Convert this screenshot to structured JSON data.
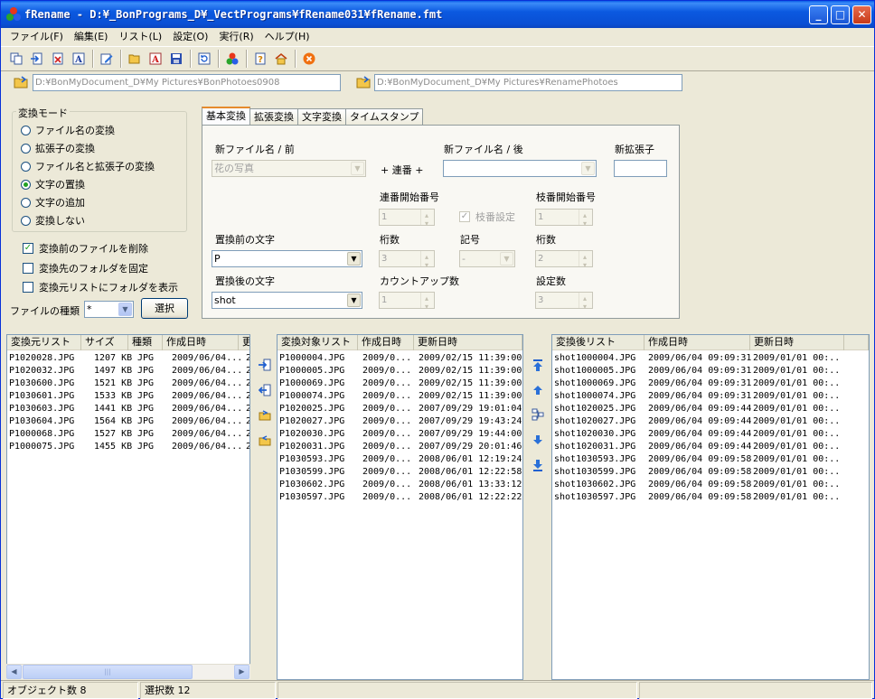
{
  "window": {
    "title": "fRename - D:¥_BonPrograms_D¥_VectPrograms¥fRename031¥fRename.fmt",
    "minimize": "_",
    "maximize": "□",
    "close": "✕"
  },
  "menu": [
    "ファイル(F)",
    "編集(E)",
    "リスト(L)",
    "設定(O)",
    "実行(R)",
    "ヘルプ(H)"
  ],
  "paths": {
    "source": "D:¥BonMyDocument_D¥My Pictures¥BonPhotoes0908",
    "target": "D:¥BonMyDocument_D¥My Pictures¥RenamePhotoes"
  },
  "mode": {
    "title": "変換モード",
    "options": [
      "ファイル名の変換",
      "拡張子の変換",
      "ファイル名と拡張子の変換",
      "文字の置換",
      "文字の追加",
      "変換しない"
    ],
    "selected_index": 3
  },
  "options": {
    "delete_source": "変換前のファイルを削除",
    "fix_target_folder": "変換先のフォルダを固定",
    "show_folders": "変換元リストにフォルダを表示"
  },
  "filetype": {
    "label": "ファイルの種類",
    "value": "*",
    "select_button": "選択"
  },
  "tabs": [
    "基本変換",
    "拡張変換",
    "文字変換",
    "タイムスタンプ"
  ],
  "basic": {
    "new_name_front_label": "新ファイル名 / 前",
    "new_name_front_value": "花の写真",
    "plus_serial": "+ 連番 +",
    "new_name_back_label": "新ファイル名 / 後",
    "new_name_back_value": "",
    "new_ext_label": "新拡張子",
    "new_ext_value": "",
    "serial_start_label": "連番開始番号",
    "serial_start_value": "1",
    "branch_setting_label": "枝番設定",
    "branch_start_label": "枝番開始番号",
    "branch_start_value": "1",
    "before_label": "置換前の文字",
    "before_value": "P",
    "digits_label": "桁数",
    "digits_value": "3",
    "symbol_label": "記号",
    "symbol_value": "-",
    "branch_digits_label": "桁数",
    "branch_digits_value": "2",
    "after_label": "置換後の文字",
    "after_value": "shot",
    "countup_label": "カウントアップ数",
    "countup_value": "1",
    "setting_count_label": "設定数",
    "setting_count_value": "3"
  },
  "source_list": {
    "headers": [
      "変換元リスト",
      "サイズ",
      "種類",
      "作成日時",
      "更"
    ],
    "rows": [
      [
        "P1020028.JPG",
        "1207 KB",
        "JPG",
        "2009/06/04...",
        "2"
      ],
      [
        "P1020032.JPG",
        "1497 KB",
        "JPG",
        "2009/06/04...",
        "2"
      ],
      [
        "P1030600.JPG",
        "1521 KB",
        "JPG",
        "2009/06/04...",
        "2"
      ],
      [
        "P1030601.JPG",
        "1533 KB",
        "JPG",
        "2009/06/04...",
        "2"
      ],
      [
        "P1030603.JPG",
        "1441 KB",
        "JPG",
        "2009/06/04...",
        "2"
      ],
      [
        "P1030604.JPG",
        "1564 KB",
        "JPG",
        "2009/06/04...",
        "2"
      ],
      [
        "P1000068.JPG",
        "1527 KB",
        "JPG",
        "2009/06/04...",
        "2"
      ],
      [
        "P1000075.JPG",
        "1455 KB",
        "JPG",
        "2009/06/04...",
        "2"
      ]
    ]
  },
  "target_list": {
    "headers": [
      "変換対象リスト",
      "作成日時",
      "更新日時"
    ],
    "rows": [
      [
        "P1000004.JPG",
        "2009/0...",
        "2009/02/15 11:39:00"
      ],
      [
        "P1000005.JPG",
        "2009/0...",
        "2009/02/15 11:39:00"
      ],
      [
        "P1000069.JPG",
        "2009/0...",
        "2009/02/15 11:39:00"
      ],
      [
        "P1000074.JPG",
        "2009/0...",
        "2009/02/15 11:39:00"
      ],
      [
        "P1020025.JPG",
        "2009/0...",
        "2007/09/29 19:01:04"
      ],
      [
        "P1020027.JPG",
        "2009/0...",
        "2007/09/29 19:43:24"
      ],
      [
        "P1020030.JPG",
        "2009/0...",
        "2007/09/29 19:44:00"
      ],
      [
        "P1020031.JPG",
        "2009/0...",
        "2007/09/29 20:01:46"
      ],
      [
        "P1030593.JPG",
        "2009/0...",
        "2008/06/01 12:19:24"
      ],
      [
        "P1030599.JPG",
        "2009/0...",
        "2008/06/01 12:22:58"
      ],
      [
        "P1030602.JPG",
        "2009/0...",
        "2008/06/01 13:33:12"
      ],
      [
        "P1030597.JPG",
        "2009/0...",
        "2008/06/01 12:22:22"
      ]
    ]
  },
  "result_list": {
    "headers": [
      "変換後リスト",
      "作成日時",
      "更新日時"
    ],
    "rows": [
      [
        "shot1000004.JPG",
        "2009/06/04 09:09:31",
        "2009/01/01 00:..."
      ],
      [
        "shot1000005.JPG",
        "2009/06/04 09:09:31",
        "2009/01/01 00:..."
      ],
      [
        "shot1000069.JPG",
        "2009/06/04 09:09:31",
        "2009/01/01 00:..."
      ],
      [
        "shot1000074.JPG",
        "2009/06/04 09:09:31",
        "2009/01/01 00:..."
      ],
      [
        "shot1020025.JPG",
        "2009/06/04 09:09:44",
        "2009/01/01 00:..."
      ],
      [
        "shot1020027.JPG",
        "2009/06/04 09:09:44",
        "2009/01/01 00:..."
      ],
      [
        "shot1020030.JPG",
        "2009/06/04 09:09:44",
        "2009/01/01 00:..."
      ],
      [
        "shot1020031.JPG",
        "2009/06/04 09:09:44",
        "2009/01/01 00:..."
      ],
      [
        "shot1030593.JPG",
        "2009/06/04 09:09:58",
        "2009/01/01 00:..."
      ],
      [
        "shot1030599.JPG",
        "2009/06/04 09:09:58",
        "2009/01/01 00:..."
      ],
      [
        "shot1030602.JPG",
        "2009/06/04 09:09:58",
        "2009/01/01 00:..."
      ],
      [
        "shot1030597.JPG",
        "2009/06/04 09:09:58",
        "2009/01/01 00:..."
      ]
    ]
  },
  "status": {
    "objects": "オブジェクト数 8",
    "selected": "選択数 12"
  },
  "colors": {
    "titlebar": "#0a4fd4",
    "face": "#ece9d8",
    "accent_tab": "#e68b2c"
  }
}
